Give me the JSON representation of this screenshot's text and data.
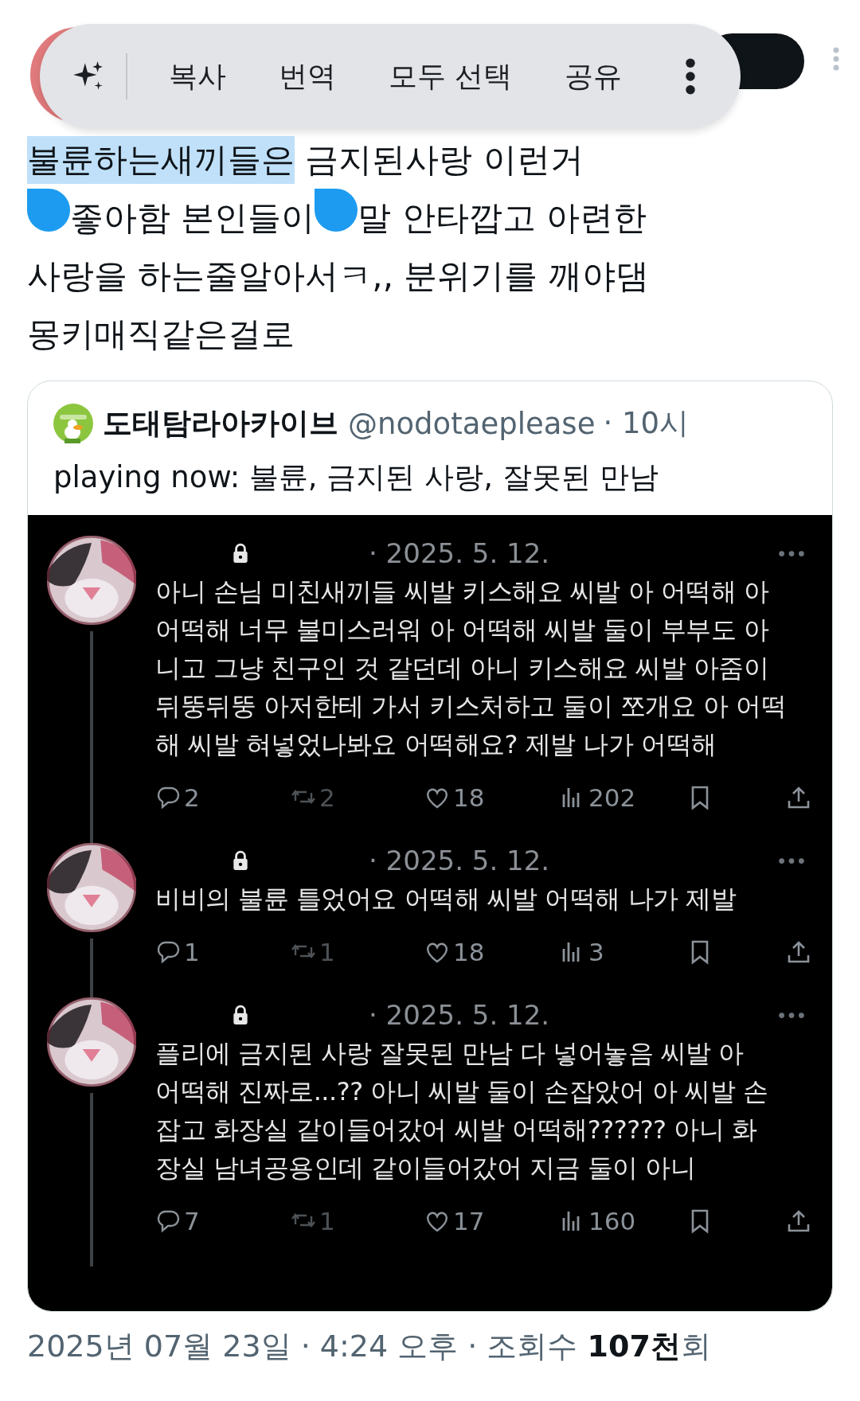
{
  "context_menu": {
    "actions": [
      "복사",
      "번역",
      "모두 선택",
      "공유"
    ]
  },
  "post": {
    "lines": [
      [
        {
          "kind": "text",
          "text": "불륜하는새끼들은",
          "selected": true
        },
        {
          "kind": "text",
          "text": " 금지된사랑 이런거",
          "selected": false
        }
      ],
      [
        {
          "kind": "handle"
        },
        {
          "kind": "text",
          "text": "좋아함 본인들이",
          "selected": false
        },
        {
          "kind": "handle"
        },
        {
          "kind": "text",
          "text": "말 안타깝고 아련한",
          "selected": false
        }
      ],
      [
        {
          "kind": "text",
          "text": "사랑을 하는줄알아서ㅋ,, 분위기를 깨야댐",
          "selected": false
        }
      ],
      [
        {
          "kind": "text",
          "text": "몽키매직같은걸로",
          "selected": false
        }
      ]
    ]
  },
  "quote": {
    "author": "도태탐라아카이브",
    "handle": "@nodotaeplease",
    "time": "· 10시",
    "text": "playing now: 불륜, 금지된 사랑, 잘못된 만남",
    "screenshot": {
      "tweets": [
        {
          "date": "· 2025. 5. 12.",
          "lines": [
            "아니 손님 미친새끼들 씨발 키스해요 씨발 아 어떡해 아",
            "어떡해 너무 불미스러워 아 어떡해 씨발 둘이 부부도 아",
            "니고 그냥 친구인 것 같던데 아니 키스해요 씨발 아줌이",
            "뒤뚱뒤뚱 아저한테 가서 키스처하고 둘이 쪼개요 아 어떡",
            "해 씨발 혀넣었나봐요 어떡해요? 제발 나가 어떡해"
          ],
          "replies": "2",
          "reposts": "2",
          "likes": "18",
          "views": "202"
        },
        {
          "date": "· 2025. 5. 12.",
          "lines": [
            "비비의 불륜 틀었어요 어떡해 씨발 어떡해 나가 제발"
          ],
          "replies": "1",
          "reposts": "1",
          "likes": "18",
          "views": "3"
        },
        {
          "date": "· 2025. 5. 12.",
          "lines": [
            "플리에 금지된 사랑 잘못된 만남 다 넣어놓음 씨발 아",
            "어떡해 진짜로...?? 아니 씨발 둘이 손잡았어 아 씨발 손",
            "잡고 화장실 같이들어갔어 씨발 어떡해?????? 아니 화",
            "장실 남녀공용인데 같이들어갔어 지금 둘이 아니"
          ],
          "replies": "7",
          "reposts": "1",
          "likes": "17",
          "views": "160"
        }
      ]
    }
  },
  "footer": "2025년 07월 23일 · 4:24 오후 · 조회수 **107천**회"
}
